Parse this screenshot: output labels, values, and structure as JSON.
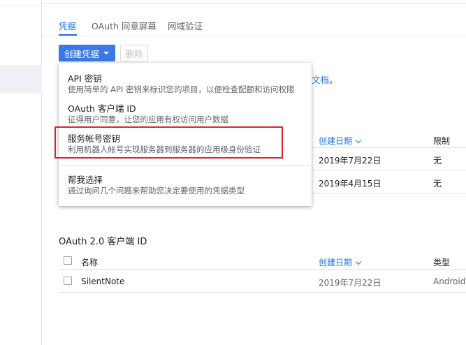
{
  "tabs": [
    {
      "label": "凭据",
      "active": true
    },
    {
      "label": "OAuth 同意屏幕",
      "active": false
    },
    {
      "label": "网域验证",
      "active": false
    }
  ],
  "toolbar": {
    "create_label": "创建凭据",
    "delete_label": "删除"
  },
  "menu": {
    "items": [
      {
        "title": "API 密钥",
        "desc": "使用简单的 API 密钥来标识您的项目，以便检查配额和访问权限"
      },
      {
        "title": "OAuth 客户端 ID",
        "desc": "征得用户同意，让您的应用有权访问用户数据"
      },
      {
        "title": "服务帐号密钥",
        "desc": "利用机器人帐号实现服务器到服务器的应用级身份验证"
      },
      {
        "title": "帮我选择",
        "desc": "通过询问几个问题来帮助您决定要使用的凭据类型"
      }
    ]
  },
  "doc_link": {
    "text": "文档",
    "suffix": "。"
  },
  "api_keys_table": {
    "headers": {
      "created": "创建日期",
      "restrictions": "限制"
    },
    "rows": [
      {
        "created": "2019年7月22日",
        "restrictions": "无"
      },
      {
        "created": "2019年4月15日",
        "restrictions": "无"
      }
    ]
  },
  "oauth_section": {
    "title": "OAuth 2.0 客户端 ID",
    "headers": {
      "name": "名称",
      "created": "创建日期",
      "type": "类型"
    },
    "rows": [
      {
        "name": "SilentNote",
        "created": "2019年7月22日",
        "type": "Android"
      }
    ]
  },
  "colors": {
    "accent": "#1a73e8",
    "primary_button": "#3b78e7",
    "highlight_border": "#e02424"
  }
}
